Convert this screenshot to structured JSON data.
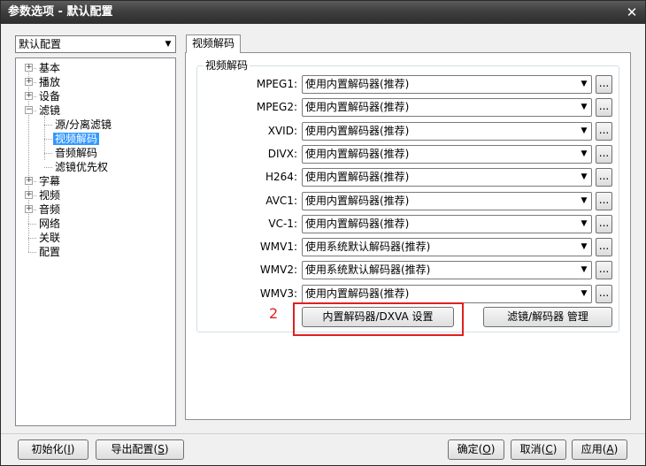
{
  "window": {
    "title": "参数选项 - 默认配置",
    "close_glyph": "✕"
  },
  "profile": {
    "selected": "默认配置"
  },
  "tree": {
    "items": [
      {
        "label": "基本",
        "expander": "+"
      },
      {
        "label": "播放",
        "expander": "+"
      },
      {
        "label": "设备",
        "expander": "+"
      },
      {
        "label": "滤镜",
        "expander": "−"
      },
      {
        "label": "源/分离滤镜"
      },
      {
        "label": "视频解码",
        "selected": true
      },
      {
        "label": "音频解码"
      },
      {
        "label": "滤镜优先权"
      },
      {
        "label": "字幕",
        "expander": "+"
      },
      {
        "label": "视频",
        "expander": "+"
      },
      {
        "label": "音频",
        "expander": "+"
      },
      {
        "label": "网络"
      },
      {
        "label": "关联"
      },
      {
        "label": "配置"
      }
    ]
  },
  "tab": {
    "label": "视频解码"
  },
  "group": {
    "title": "视频解码",
    "codecs": [
      {
        "label": "MPEG1:",
        "value": "使用内置解码器(推荐)"
      },
      {
        "label": "MPEG2:",
        "value": "使用内置解码器(推荐)"
      },
      {
        "label": "XVID:",
        "value": "使用内置解码器(推荐)"
      },
      {
        "label": "DIVX:",
        "value": "使用内置解码器(推荐)"
      },
      {
        "label": "H264:",
        "value": "使用内置解码器(推荐)"
      },
      {
        "label": "AVC1:",
        "value": "使用内置解码器(推荐)"
      },
      {
        "label": "VC-1:",
        "value": "使用内置解码器(推荐)"
      },
      {
        "label": "WMV1:",
        "value": "使用系统默认解码器(推荐)"
      },
      {
        "label": "WMV2:",
        "value": "使用系统默认解码器(推荐)"
      },
      {
        "label": "WMV3:",
        "value": "使用内置解码器(推荐)"
      }
    ],
    "dots_label": "...",
    "dxva_button": "内置解码器/DXVA 设置",
    "filter_mgr_button": "滤镜/解码器 管理"
  },
  "annotation": {
    "number": "2",
    "color": "#e02020"
  },
  "footer": {
    "init_label": "初始化",
    "init_key": "I",
    "export_label": "导出配置",
    "export_key": "S",
    "ok_label": "确定",
    "ok_key": "O",
    "cancel_label": "取消",
    "cancel_key": "C",
    "apply_label": "应用",
    "apply_key": "A"
  }
}
